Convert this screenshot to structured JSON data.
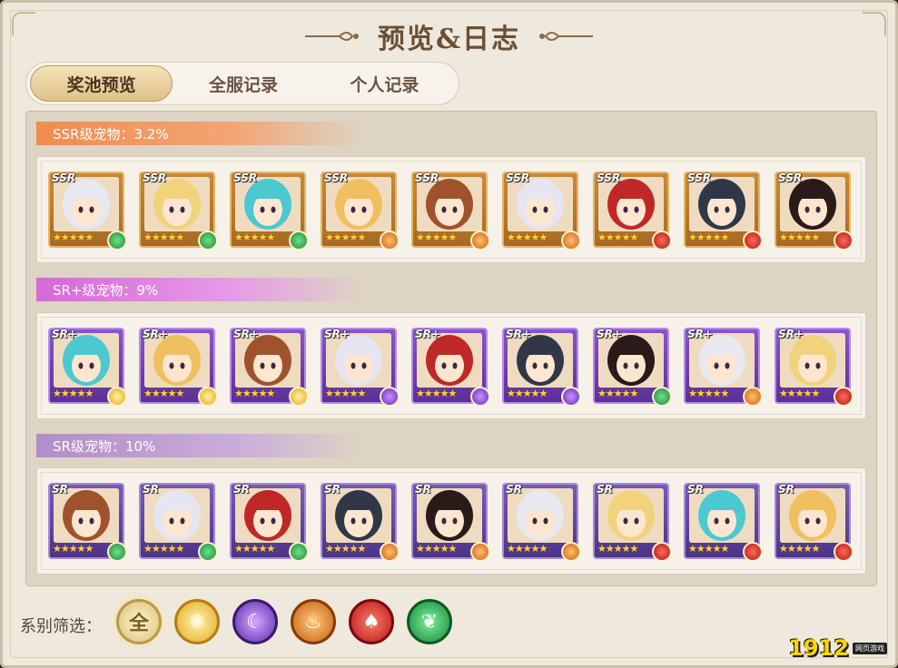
{
  "header": {
    "title": "预览&日志"
  },
  "tabs": [
    {
      "label": "奖池预览",
      "active": true
    },
    {
      "label": "全服记录",
      "active": false
    },
    {
      "label": "个人记录",
      "active": false
    }
  ],
  "tiers": [
    {
      "label": "SSR级宠物：3.2%",
      "rarity_tag": "SSR",
      "pets": [
        {
          "element": "green",
          "stars": 5
        },
        {
          "element": "green",
          "stars": 5
        },
        {
          "element": "green",
          "stars": 5
        },
        {
          "element": "orange",
          "stars": 5
        },
        {
          "element": "orange",
          "stars": 5
        },
        {
          "element": "orange",
          "stars": 5
        },
        {
          "element": "red",
          "stars": 5
        },
        {
          "element": "red",
          "stars": 5
        },
        {
          "element": "red",
          "stars": 5
        }
      ]
    },
    {
      "label": "SR+级宠物：9%",
      "rarity_tag": "SR+",
      "pets": [
        {
          "element": "gold",
          "stars": 5
        },
        {
          "element": "gold",
          "stars": 5
        },
        {
          "element": "gold",
          "stars": 5
        },
        {
          "element": "purple",
          "stars": 5
        },
        {
          "element": "purple",
          "stars": 5
        },
        {
          "element": "purple",
          "stars": 5
        },
        {
          "element": "green",
          "stars": 5
        },
        {
          "element": "orange",
          "stars": 5
        },
        {
          "element": "red",
          "stars": 5
        }
      ]
    },
    {
      "label": "SR级宠物：10%",
      "rarity_tag": "SR",
      "pets": [
        {
          "element": "green",
          "stars": 5
        },
        {
          "element": "green",
          "stars": 5
        },
        {
          "element": "green",
          "stars": 5
        },
        {
          "element": "orange",
          "stars": 5
        },
        {
          "element": "orange",
          "stars": 5
        },
        {
          "element": "orange",
          "stars": 5
        },
        {
          "element": "red",
          "stars": 5
        },
        {
          "element": "red",
          "stars": 5
        },
        {
          "element": "red",
          "stars": 5
        }
      ]
    }
  ],
  "filter": {
    "label": "系别筛选：",
    "options": [
      {
        "name": "all",
        "glyph": "全"
      },
      {
        "name": "light",
        "glyph": "✺"
      },
      {
        "name": "dark",
        "glyph": "☾"
      },
      {
        "name": "earth",
        "glyph": "♨"
      },
      {
        "name": "fire",
        "glyph": "♠"
      },
      {
        "name": "wood",
        "glyph": "❦"
      }
    ]
  },
  "watermark": {
    "number": "1912",
    "sub": "网页游戏"
  },
  "colors": {
    "ssr": "#f08c4f",
    "srp": "#d668d6",
    "sr": "#b28dc8",
    "star": "#ffd23a"
  }
}
